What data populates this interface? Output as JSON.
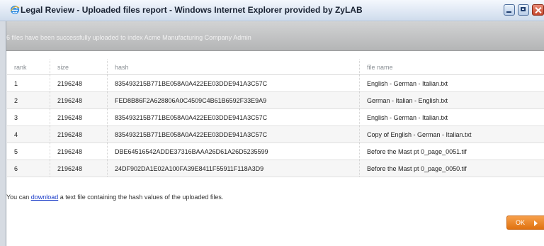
{
  "window": {
    "title": "Legal Review - Uploaded files report - Windows Internet Explorer provided by ZyLAB",
    "ie_icon": "ie-e-icon",
    "minimize_icon": "minimize-icon",
    "maximize_icon": "maximize-icon",
    "close_icon": "close-icon"
  },
  "banner": {
    "message": "6 files have been successfully uploaded to index Acme Manufacturing Company Admin"
  },
  "table": {
    "headers": {
      "rank": "rank",
      "size": "size",
      "hash": "hash",
      "file_name": "file name"
    },
    "rows": [
      {
        "rank": "1",
        "size": "2196248",
        "hash": "835493215B771BE058A0A422EE03DDE941A3C57C",
        "file_name": "English - German - Italian.txt"
      },
      {
        "rank": "2",
        "size": "2196248",
        "hash": "FED8B86F2A628806A0C4509C4B61B6592F33E9A9",
        "file_name": "German - Italian - English.txt"
      },
      {
        "rank": "3",
        "size": "2196248",
        "hash": "835493215B771BE058A0A422EE03DDE941A3C57C",
        "file_name": "English - German - Italian.txt"
      },
      {
        "rank": "4",
        "size": "2196248",
        "hash": "835493215B771BE058A0A422EE03DDE941A3C57C",
        "file_name": "Copy of English - German - Italian.txt"
      },
      {
        "rank": "5",
        "size": "2196248",
        "hash": "DBE64516542ADDE37316BAAA26D61A26D5235599",
        "file_name": "Before the Mast pt 0_page_0051.tif"
      },
      {
        "rank": "6",
        "size": "2196248",
        "hash": "24DF902DA1E02A100FA39E8411F55911F118A3D9",
        "file_name": "Before the Mast pt 0_page_0050.tif"
      }
    ]
  },
  "footer": {
    "prefix": "You can ",
    "link": "download",
    "suffix": " a text file containing the hash values of the uploaded files."
  },
  "ok_button": {
    "label": "OK",
    "icon": "arrow-right-icon",
    "color": "#f08a24"
  }
}
